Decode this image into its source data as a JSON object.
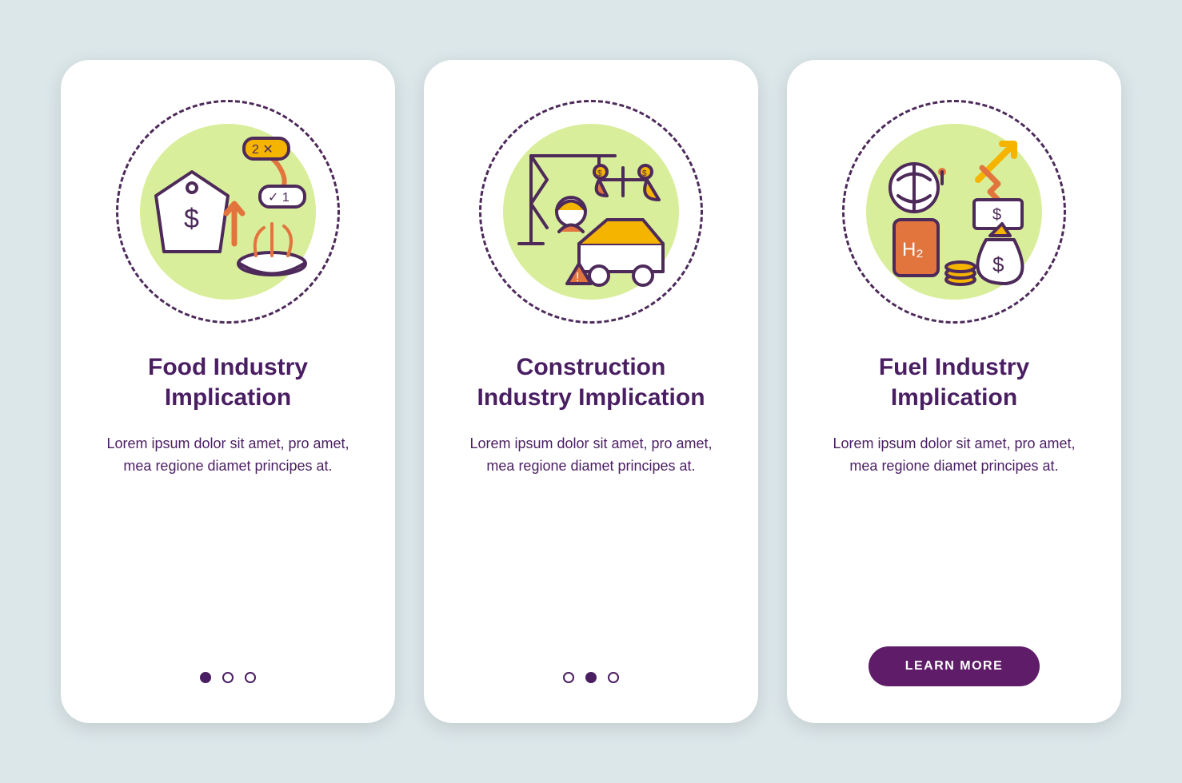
{
  "colors": {
    "bg": "#dce7ea",
    "card": "#ffffff",
    "accent": "#5f1c68",
    "text": "#4a1e62",
    "ring": "#4d2a5a",
    "green": "#d9ee9a",
    "orange": "#e2753e",
    "yellow": "#f4b400"
  },
  "cards": [
    {
      "icon": "food-price-icon",
      "title": "Food Industry\nImplication",
      "desc": "Lorem ipsum dolor sit amet, pro amet, mea regione diamet principes at.",
      "footer": "dots",
      "activeDot": 0
    },
    {
      "icon": "construction-icon",
      "title": "Construction\nIndustry Implication",
      "desc": "Lorem ipsum dolor sit amet, pro amet, mea regione diamet principes at.",
      "footer": "dots",
      "activeDot": 1
    },
    {
      "icon": "fuel-icon",
      "title": "Fuel Industry\nImplication",
      "desc": "Lorem ipsum dolor sit amet, pro amet, mea regione diamet principes at.",
      "footer": "button",
      "buttonLabel": "LEARN MORE"
    }
  ]
}
